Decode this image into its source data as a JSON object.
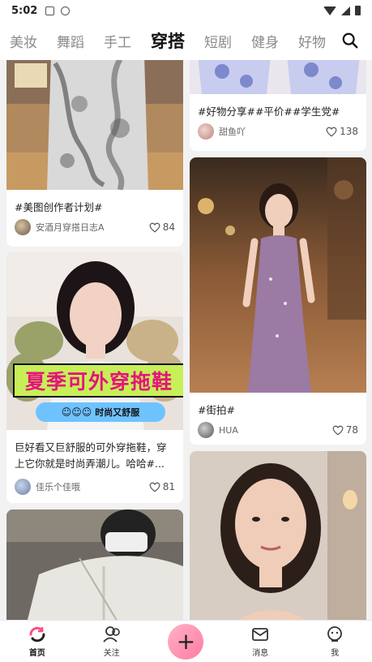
{
  "status_bar": {
    "time": "5:02"
  },
  "tabs": [
    {
      "label": "美妆",
      "active": false
    },
    {
      "label": "舞蹈",
      "active": false
    },
    {
      "label": "手工",
      "active": false
    },
    {
      "label": "穿搭",
      "active": true
    },
    {
      "label": "短剧",
      "active": false
    },
    {
      "label": "健身",
      "active": false
    },
    {
      "label": "好物",
      "active": false
    }
  ],
  "feed": {
    "left": [
      {
        "title": "#美图创作者计划#",
        "author": "安酒月穿搭日志A",
        "likes": "84"
      },
      {
        "title": "巨好看又巨舒服的可外穿拖鞋，穿上它你就是时尚弄潮儿。哈哈#...",
        "author": "佳乐个佳哦",
        "likes": "81",
        "overlay_main": "夏季可外穿拖鞋",
        "overlay_sub": "时尚又舒服",
        "overlay_smiles": "☺☺☺"
      }
    ],
    "right": [
      {
        "title": "#好物分享##平价##学生党#",
        "author": "甜鱼吖",
        "likes": "138"
      },
      {
        "title": "#街拍#",
        "author": "HUA",
        "likes": "78"
      }
    ]
  },
  "bottom_nav": [
    {
      "label": "首页",
      "active": true
    },
    {
      "label": "关注",
      "active": false
    },
    {
      "label": "",
      "active": false
    },
    {
      "label": "消息",
      "active": false
    },
    {
      "label": "我",
      "active": false
    }
  ],
  "colors": {
    "accent_pink": "#ff7aa2",
    "banner_green": "#c7ef58",
    "banner_text": "#e6137c"
  }
}
